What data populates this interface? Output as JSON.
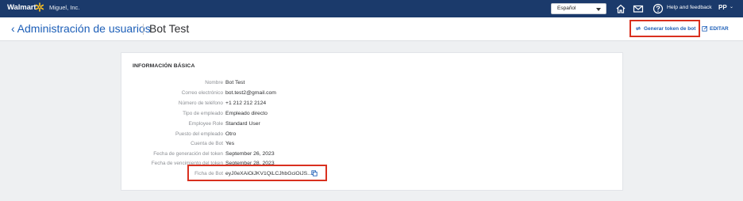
{
  "topbar": {
    "brand": "Walmart",
    "company": "Miguel, Inc.",
    "language": "Español",
    "icons": [
      "home-icon",
      "mail-icon",
      "help-icon"
    ],
    "help_label": "Help and feedback",
    "user_initials": "PP"
  },
  "header": {
    "back_label": "Administración de usuarios",
    "title": "Bot Test",
    "generate_token_label": "Generar token de bot",
    "edit_label": "EDITAR"
  },
  "card": {
    "section_title": "INFORMACIÓN BÁSICA",
    "fields": [
      {
        "label": "Nombre",
        "value": "Bot Test"
      },
      {
        "label": "Correo electrónico",
        "value": "bot.test2@gmail.com"
      },
      {
        "label": "Número de teléfono",
        "value": "+1 212 212 2124"
      },
      {
        "label": "Tipo de empleado",
        "value": "Empleado directo"
      },
      {
        "label": "Employee Role",
        "value": "Standard User"
      },
      {
        "label": "Puesto del empleado",
        "value": "Otro"
      },
      {
        "label": "Cuenta de Bot",
        "value": "Yes"
      },
      {
        "label": "Fecha de generación del token",
        "value": "September 26, 2023"
      },
      {
        "label": "Fecha de vencimiento del token",
        "value": "September 28, 2023"
      },
      {
        "label": "Ficha de Bot",
        "value": "eyJ0eXAiOiJKV1QiLCJhbGciOiJS..."
      }
    ]
  },
  "colors": {
    "nav_bg": "#1b3a6b",
    "link": "#1d5fb8",
    "highlight": "#d9301f",
    "spark": "#ffc220"
  }
}
